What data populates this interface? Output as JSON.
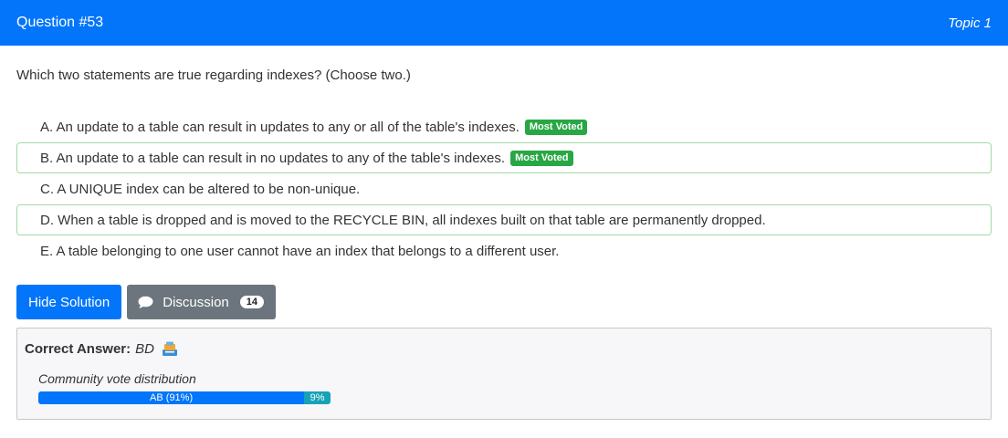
{
  "header": {
    "question_number": "Question #53",
    "topic": "Topic 1"
  },
  "question": {
    "text": "Which two statements are true regarding indexes? (Choose two.)"
  },
  "choices": [
    {
      "text": "A. An update to a table can result in updates to any or all of the table's indexes.",
      "badge": "Most Voted",
      "correct": false
    },
    {
      "text": "B. An update to a table can result in no updates to any of the table's indexes.",
      "badge": "Most Voted",
      "correct": true
    },
    {
      "text": "C. A UNIQUE index can be altered to be non-unique.",
      "badge": "",
      "correct": false
    },
    {
      "text": "D. When a table is dropped and is moved to the RECYCLE BIN, all indexes built on that table are permanently dropped.",
      "badge": "",
      "correct": true
    },
    {
      "text": "E. A table belonging to one user cannot have an index that belongs to a different user.",
      "badge": "",
      "correct": false
    }
  ],
  "buttons": {
    "hide_solution": "Hide Solution",
    "discussion": "Discussion",
    "discussion_count": "14"
  },
  "answer": {
    "label": "Correct Answer:",
    "value": "BD",
    "distribution_label": "Community vote distribution",
    "distribution": [
      {
        "label": "AB (91%)",
        "percent": 91
      },
      {
        "label": "9%",
        "percent": 9
      }
    ]
  },
  "colors": {
    "primary": "#0275fa",
    "success": "#28a745",
    "info": "#17a2b8",
    "secondary": "#6c757d"
  },
  "icons": {
    "discussion": "chat-bubble-icon",
    "answer": "equalizer-icon"
  }
}
